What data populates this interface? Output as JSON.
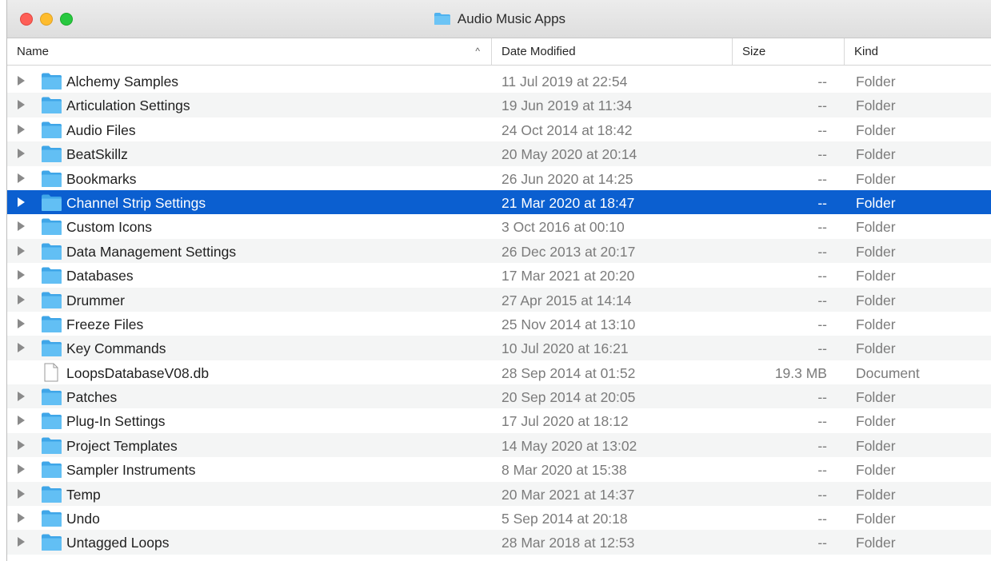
{
  "window": {
    "title": "Audio Music Apps"
  },
  "columns": {
    "name": "Name",
    "date": "Date Modified",
    "size": "Size",
    "kind": "Kind",
    "sort_indicator": "^"
  },
  "colors": {
    "selection": "#0b5fd0",
    "folder": "#4fb2ef"
  },
  "rows": [
    {
      "name": "Alchemy Samples",
      "date": "11 Jul 2019 at 22:54",
      "size": "--",
      "kind": "Folder",
      "icon": "folder-icon",
      "expandable": true
    },
    {
      "name": "Articulation Settings",
      "date": "19 Jun 2019 at 11:34",
      "size": "--",
      "kind": "Folder",
      "icon": "folder-icon",
      "expandable": true
    },
    {
      "name": "Audio Files",
      "date": "24 Oct 2014 at 18:42",
      "size": "--",
      "kind": "Folder",
      "icon": "folder-icon",
      "expandable": true
    },
    {
      "name": "BeatSkillz",
      "date": "20 May 2020 at 20:14",
      "size": "--",
      "kind": "Folder",
      "icon": "folder-icon",
      "expandable": true
    },
    {
      "name": "Bookmarks",
      "date": "26 Jun 2020 at 14:25",
      "size": "--",
      "kind": "Folder",
      "icon": "folder-icon",
      "expandable": true
    },
    {
      "name": "Channel Strip Settings",
      "date": "21 Mar 2020 at 18:47",
      "size": "--",
      "kind": "Folder",
      "icon": "folder-icon",
      "expandable": true,
      "selected": true
    },
    {
      "name": "Custom Icons",
      "date": "3 Oct 2016 at 00:10",
      "size": "--",
      "kind": "Folder",
      "icon": "folder-icon",
      "expandable": true
    },
    {
      "name": "Data Management Settings",
      "date": "26 Dec 2013 at 20:17",
      "size": "--",
      "kind": "Folder",
      "icon": "folder-icon",
      "expandable": true
    },
    {
      "name": "Databases",
      "date": "17 Mar 2021 at 20:20",
      "size": "--",
      "kind": "Folder",
      "icon": "folder-icon",
      "expandable": true
    },
    {
      "name": "Drummer",
      "date": "27 Apr 2015 at 14:14",
      "size": "--",
      "kind": "Folder",
      "icon": "folder-icon",
      "expandable": true
    },
    {
      "name": "Freeze Files",
      "date": "25 Nov 2014 at 13:10",
      "size": "--",
      "kind": "Folder",
      "icon": "folder-icon",
      "expandable": true
    },
    {
      "name": "Key Commands",
      "date": "10 Jul 2020 at 16:21",
      "size": "--",
      "kind": "Folder",
      "icon": "folder-icon",
      "expandable": true
    },
    {
      "name": "LoopsDatabaseV08.db",
      "date": "28 Sep 2014 at 01:52",
      "size": "19.3 MB",
      "kind": "Document",
      "icon": "document-icon",
      "expandable": false
    },
    {
      "name": "Patches",
      "date": "20 Sep 2014 at 20:05",
      "size": "--",
      "kind": "Folder",
      "icon": "folder-icon",
      "expandable": true
    },
    {
      "name": "Plug-In Settings",
      "date": "17 Jul 2020 at 18:12",
      "size": "--",
      "kind": "Folder",
      "icon": "folder-icon",
      "expandable": true
    },
    {
      "name": "Project Templates",
      "date": "14 May 2020 at 13:02",
      "size": "--",
      "kind": "Folder",
      "icon": "folder-icon",
      "expandable": true
    },
    {
      "name": "Sampler Instruments",
      "date": "8 Mar 2020 at 15:38",
      "size": "--",
      "kind": "Folder",
      "icon": "folder-icon",
      "expandable": true
    },
    {
      "name": "Temp",
      "date": "20 Mar 2021 at 14:37",
      "size": "--",
      "kind": "Folder",
      "icon": "folder-icon",
      "expandable": true
    },
    {
      "name": "Undo",
      "date": "5 Sep 2014 at 20:18",
      "size": "--",
      "kind": "Folder",
      "icon": "folder-icon",
      "expandable": true
    },
    {
      "name": "Untagged Loops",
      "date": "28 Mar 2018 at 12:53",
      "size": "--",
      "kind": "Folder",
      "icon": "folder-icon",
      "expandable": true
    }
  ]
}
